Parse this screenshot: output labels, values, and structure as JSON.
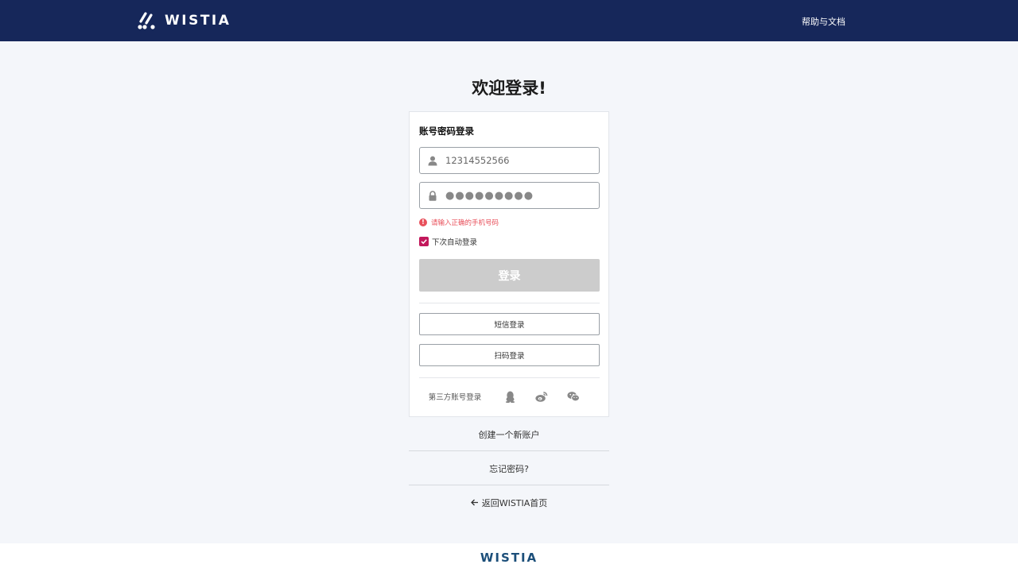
{
  "header": {
    "brand": "WISTIA",
    "help_link": "帮助与文档"
  },
  "welcome_title": "欢迎登录!",
  "login_card": {
    "title": "账号密码登录",
    "username_value": "12314552566",
    "password_value": "●●●●●●●●●",
    "error_message": "请输入正确的手机号码",
    "remember_label": "下次自动登录",
    "remember_checked": true,
    "login_button": "登录",
    "sms_login_button": "短信登录",
    "qr_login_button": "扫码登录",
    "third_party_label": "第三方账号登录",
    "third_party_icons": [
      "qq-icon",
      "weibo-icon",
      "wechat-icon"
    ]
  },
  "links": {
    "create_account": "创建一个新账户",
    "forgot_password": "忘记密码?",
    "back_home": "返回WISTIA首页"
  },
  "footer": {
    "brand": "WISTIA"
  },
  "colors": {
    "header_bg": "#16275a",
    "page_bg": "#f4f6fa",
    "error": "#e8505b",
    "checkbox": "#c2185b",
    "disabled_button": "#cccccc",
    "footer_brand": "#1c4f7a"
  }
}
